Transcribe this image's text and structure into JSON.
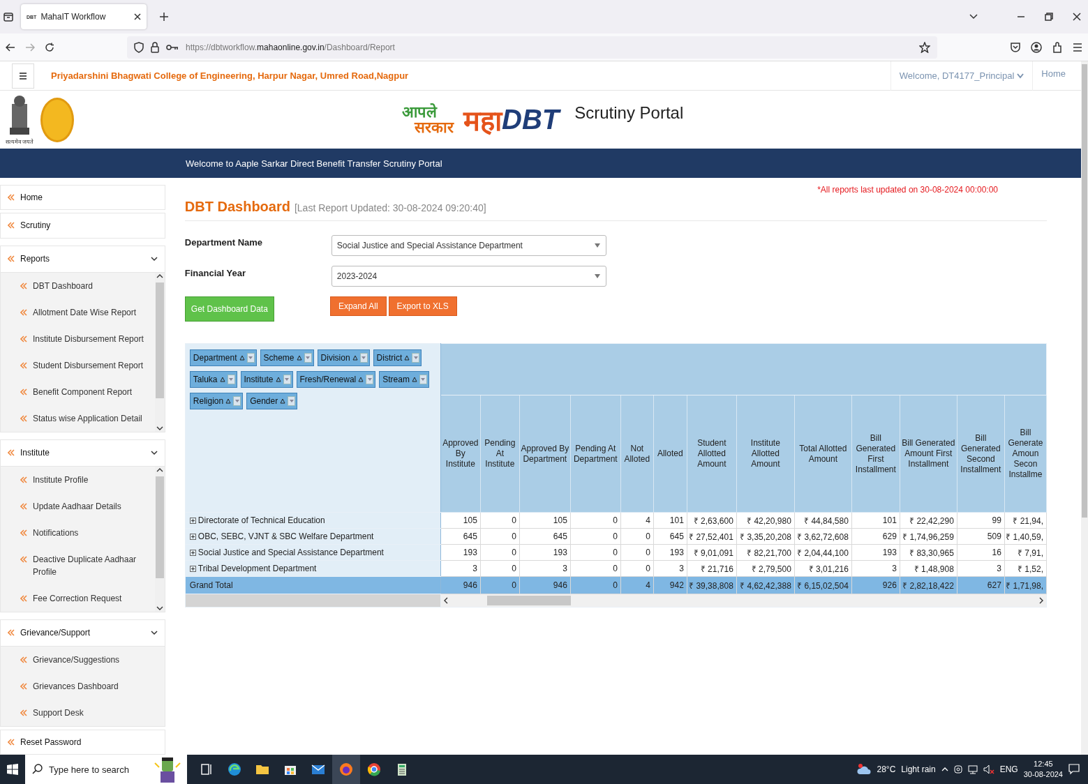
{
  "browser": {
    "tab": {
      "favicon_text": "DBT",
      "title": "MahaIT Workflow",
      "selected": true
    },
    "url": {
      "before": "https://dbtworkflow.",
      "domain": "mahaonline.gov.in",
      "after": "/Dashboard/Report"
    }
  },
  "topbar": {
    "college": "Priyadarshini Bhagwati College of Engineering, Harpur Nagar, Umred Road,Nagpur",
    "welcome": "Welcome, DT4177_Principal",
    "home": "Home"
  },
  "header": {
    "emblem_motto": "सत्यमेव जयते",
    "logo_aaple": "आपले",
    "logo_sarkar": "सरकार",
    "logo_maha": "महा",
    "logo_dbt": "DBT",
    "portal": "Scrutiny Portal"
  },
  "banner": "Welcome to Aaple Sarkar Direct Benefit Transfer Scrutiny Portal",
  "sidebar": {
    "items": [
      {
        "kind": "link",
        "label": "Home"
      },
      {
        "kind": "link",
        "label": "Scrutiny"
      },
      {
        "kind": "group",
        "label": "Reports",
        "expanded": true,
        "children": [
          {
            "label": "DBT Dashboard"
          },
          {
            "label": "Allotment Date Wise Report"
          },
          {
            "label": "Institute Disbursement Report"
          },
          {
            "label": "Student Disbursement Report"
          },
          {
            "label": "Benefit Component Report"
          },
          {
            "label": "Status wise Application Detail"
          }
        ]
      },
      {
        "kind": "group",
        "label": "Institute",
        "expanded": true,
        "children": [
          {
            "label": "Institute Profile"
          },
          {
            "label": "Update Aadhaar Details"
          },
          {
            "label": "Notifications"
          },
          {
            "label": "Deactive Duplicate Aadhaar Profile"
          },
          {
            "label": "Fee Correction Request"
          }
        ]
      },
      {
        "kind": "group",
        "label": "Grievance/Support",
        "expanded": true,
        "children": [
          {
            "label": "Grievance/Suggestions"
          },
          {
            "label": "Grievances Dashboard"
          },
          {
            "label": "Support Desk"
          }
        ]
      },
      {
        "kind": "link",
        "label": "Reset Password"
      }
    ]
  },
  "dashboard": {
    "title": "DBT Dashboard",
    "updated": "[Last Report Updated: 30-08-2024 09:20:40]",
    "notice": "*All reports last updated on 30-08-2024 00:00:00",
    "filters": [
      {
        "label": "Department Name",
        "value": "Social Justice and Special Assistance Department"
      },
      {
        "label": "Financial Year",
        "value": "2023-2024"
      }
    ],
    "buttons": [
      {
        "kind": "primary",
        "label": "Get Dashboard Data"
      },
      {
        "kind": "action",
        "label": "Expand All"
      },
      {
        "kind": "action",
        "label": "Export to XLS"
      }
    ]
  },
  "pivot": {
    "fields": [
      [
        {
          "label": "Department"
        },
        {
          "label": "Scheme"
        },
        {
          "label": "Division"
        },
        {
          "label": "District"
        }
      ],
      [
        {
          "label": "Taluka"
        },
        {
          "label": "Institute"
        },
        {
          "label": "Fresh/Renewal"
        },
        {
          "label": "Stream"
        }
      ],
      [
        {
          "label": "Religion"
        },
        {
          "label": "Gender"
        }
      ]
    ],
    "columns": [
      "Approved By Institute",
      "Pending At Institute",
      "Approved By Department",
      "Pending At Department",
      "Not Alloted",
      "Alloted",
      "Student Allotted Amount",
      "Institute Allotted Amount",
      "Total Allotted Amount",
      "Bill Generated First Installment",
      "Bill Generated Amount First Installment",
      "Bill Generated Second Installment",
      "Bill Generate Amoun Secon Installme"
    ],
    "rows": [
      {
        "kind": "group",
        "label": "Directorate of Technical Education",
        "cells": [
          "105",
          "0",
          "105",
          "0",
          "4",
          "101",
          "₹ 2,63,600",
          "₹ 42,20,980",
          "₹ 44,84,580",
          "101",
          "₹ 22,42,290",
          "99",
          "₹ 21,94,"
        ]
      },
      {
        "kind": "group",
        "label": "OBC, SEBC, VJNT & SBC Welfare Department",
        "cells": [
          "645",
          "0",
          "645",
          "0",
          "0",
          "645",
          "₹ 27,52,401",
          "₹ 3,35,20,208",
          "₹ 3,62,72,608",
          "629",
          "₹ 1,74,96,259",
          "509",
          "₹ 1,40,59,"
        ]
      },
      {
        "kind": "group",
        "label": "Social Justice and Special Assistance Department",
        "cells": [
          "193",
          "0",
          "193",
          "0",
          "0",
          "193",
          "₹ 9,01,091",
          "₹ 82,21,700",
          "₹ 2,04,44,100",
          "193",
          "₹ 83,30,965",
          "16",
          "₹ 7,91,"
        ]
      },
      {
        "kind": "group",
        "label": "Tribal Development Department",
        "cells": [
          "3",
          "0",
          "3",
          "0",
          "0",
          "3",
          "₹ 21,716",
          "₹ 2,79,500",
          "₹ 3,01,216",
          "3",
          "₹ 1,48,908",
          "3",
          "₹ 1,52,"
        ]
      },
      {
        "kind": "total",
        "label": "Grand Total",
        "cells": [
          "946",
          "0",
          "946",
          "0",
          "4",
          "942",
          "₹ 39,38,808",
          "₹ 4,62,42,388",
          "₹ 6,15,02,504",
          "926",
          "₹ 2,82,18,422",
          "627",
          "₹ 1,71,98,"
        ]
      }
    ]
  },
  "taskbar": {
    "search_placeholder": "Type here to search",
    "temperature": "28°C",
    "weather": "Light rain",
    "language": "ENG",
    "time": "12:45",
    "date": "30-08-2024"
  }
}
